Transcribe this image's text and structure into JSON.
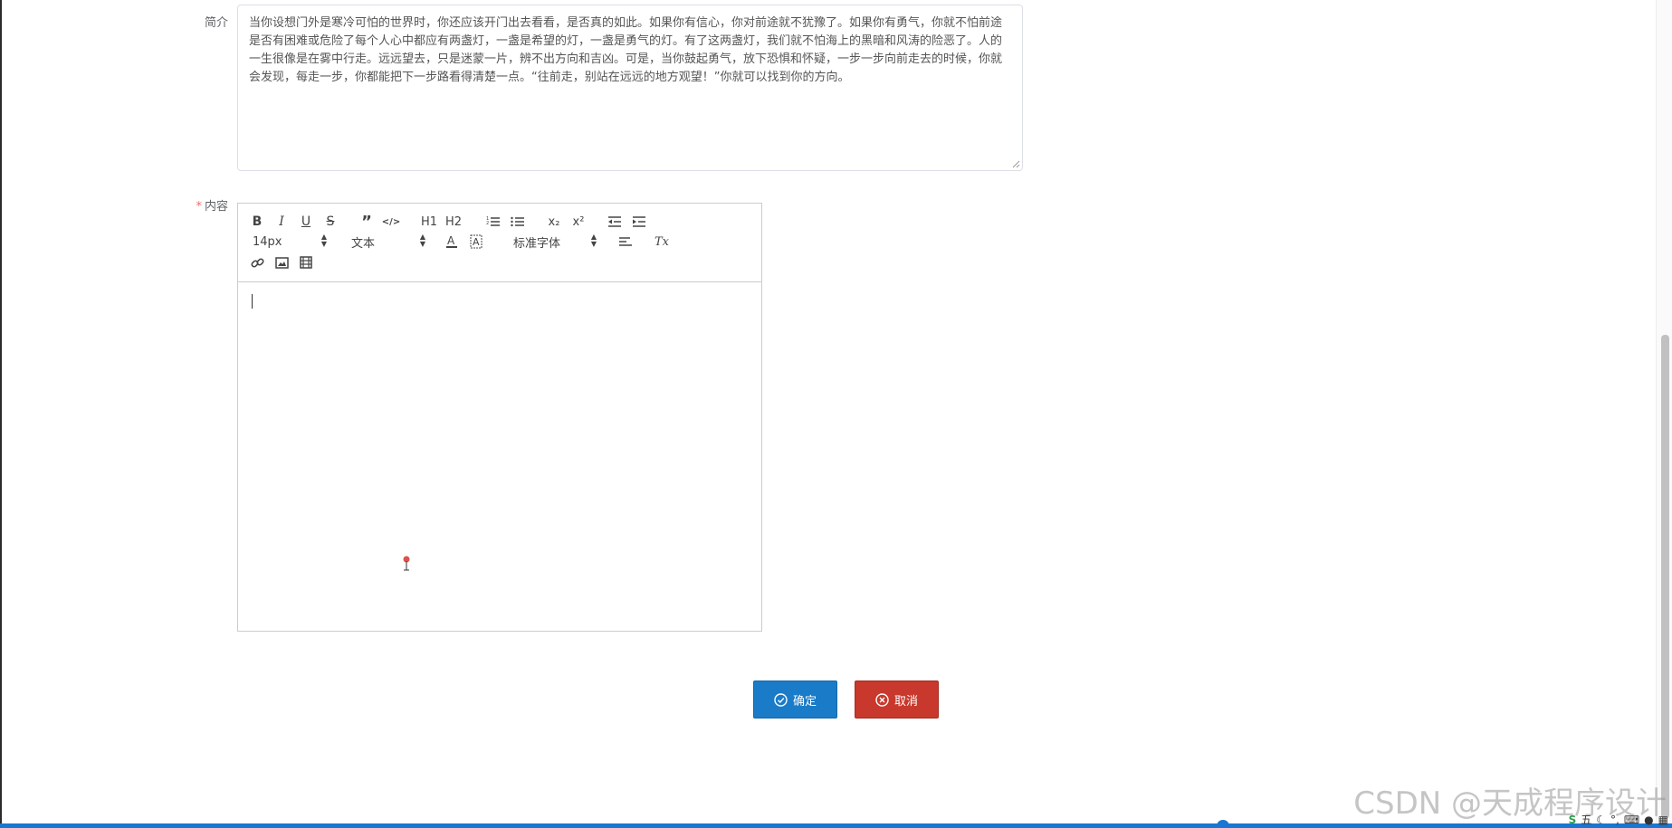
{
  "form": {
    "intro_label": "简介",
    "intro_text": "当你设想门外是寒冷可怕的世界时，你还应该开门出去看看，是否真的如此。如果你有信心，你对前途就不犹豫了。如果你有勇气，你就不怕前途是否有困难或危险了每个人心中都应有两盏灯，一盏是希望的灯，一盏是勇气的灯。有了这两盏灯，我们就不怕海上的黑暗和风涛的险恶了。人的一生很像是在雾中行走。远远望去，只是迷蒙一片，辨不出方向和吉凶。可是，当你鼓起勇气，放下恐惧和怀疑，一步一步向前走去的时候，你就会发现，每走一步，你都能把下一步路看得清楚一点。“往前走，别站在远远的地方观望！”你就可以找到你的方向。",
    "content_required_mark": "*",
    "content_label": "内容"
  },
  "editor": {
    "toolbar": {
      "bold": "B",
      "italic": "I",
      "underline": "U",
      "strike": "S",
      "blockquote": "”",
      "code": "</>",
      "h1": "H1",
      "h2": "H2",
      "subscript": "x₂",
      "superscript": "x²",
      "clean": "Tx",
      "size_select": "14px",
      "header_select": "文本",
      "font_select": "标准字体"
    }
  },
  "actions": {
    "confirm_label": "确定",
    "cancel_label": "取消"
  },
  "watermark": "CSDN @天成程序设计",
  "tray": {
    "ime_label": "五"
  },
  "colors": {
    "confirm": "#1a7bc8",
    "cancel": "#c9382c",
    "taskbar": "#1976d2",
    "required": "#f56c6c"
  }
}
